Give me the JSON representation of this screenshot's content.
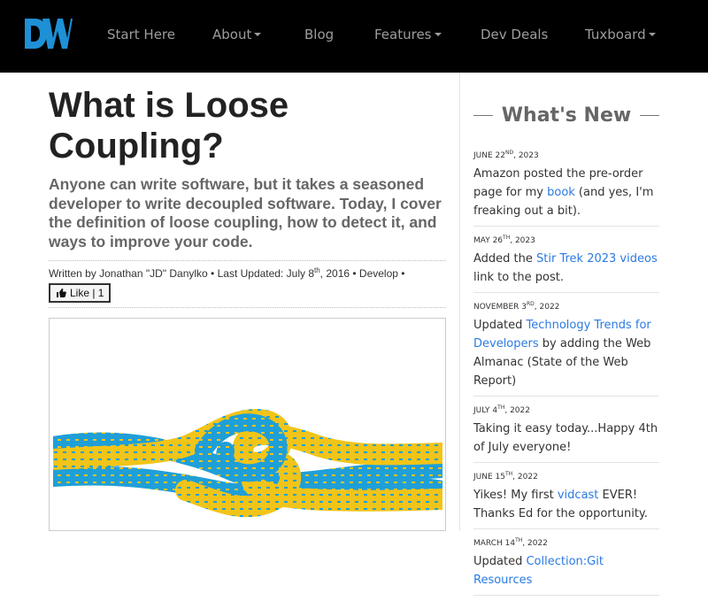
{
  "nav": {
    "logo_text": "DW",
    "items": [
      {
        "label": "Start Here",
        "has_dropdown": false
      },
      {
        "label": "About",
        "has_dropdown": true
      },
      {
        "label": "Blog",
        "has_dropdown": false
      },
      {
        "label": "Features",
        "has_dropdown": true
      },
      {
        "label": "Dev Deals",
        "has_dropdown": false
      },
      {
        "label": "Tuxboard",
        "has_dropdown": true
      }
    ]
  },
  "article": {
    "title": "What is Loose Coupling?",
    "subtitle": "Anyone can write software, but it takes a seasoned developer to write decoupled software. Today, I cover the definition of loose coupling, how to detect it, and ways to improve your code.",
    "byline": {
      "author_prefix": "Written by Jonathan \"JD\" Danylko",
      "sep1": " • ",
      "updated_prefix": "Last Updated: July 8",
      "updated_sup": "th",
      "updated_suffix": ", 2016",
      "sep2": " • ",
      "category": "Develop",
      "sep3": " •"
    },
    "like_button": {
      "label": "Like | 1",
      "icon": "thumbs-up-icon"
    },
    "hero_image_alt": "knot-of-two-ropes"
  },
  "sidebar": {
    "heading": "What's New",
    "items": [
      {
        "month_day": "JUNE 22",
        "sup": "ND",
        "year": ", 2023",
        "pre": "Amazon posted the pre-order page for my ",
        "link": "book",
        "post": " (and yes, I'm freaking out a bit)."
      },
      {
        "month_day": "MAY 26",
        "sup": "TH",
        "year": ", 2023",
        "pre": "Added the ",
        "link": "Stir Trek 2023 videos",
        "post": " link to the post."
      },
      {
        "month_day": "NOVEMBER 3",
        "sup": "RD",
        "year": ", 2022",
        "pre": "Updated ",
        "link": "Technology Trends for Developers",
        "post": " by adding the Web Almanac (State of the Web Report)"
      },
      {
        "month_day": "JULY 4",
        "sup": "TH",
        "year": ", 2022",
        "pre": "Taking it easy today...Happy 4th of July everyone!",
        "link": "",
        "post": ""
      },
      {
        "month_day": "JUNE 15",
        "sup": "TH",
        "year": ", 2022",
        "pre": "Yikes! My first ",
        "link": "vidcast",
        "post": " EVER! Thanks Ed for the opportunity."
      },
      {
        "month_day": "MARCH 14",
        "sup": "TH",
        "year": ", 2022",
        "pre": "Updated ",
        "link": "Collection:Git Resources",
        "post": ""
      }
    ]
  },
  "colors": {
    "nav_bg": "#000000",
    "nav_text": "#9d9d9d",
    "logo_blue": "#1e90d6",
    "link": "#2a7ae2",
    "rope_yellow": "#f1c419",
    "rope_blue": "#1f9fd8"
  }
}
